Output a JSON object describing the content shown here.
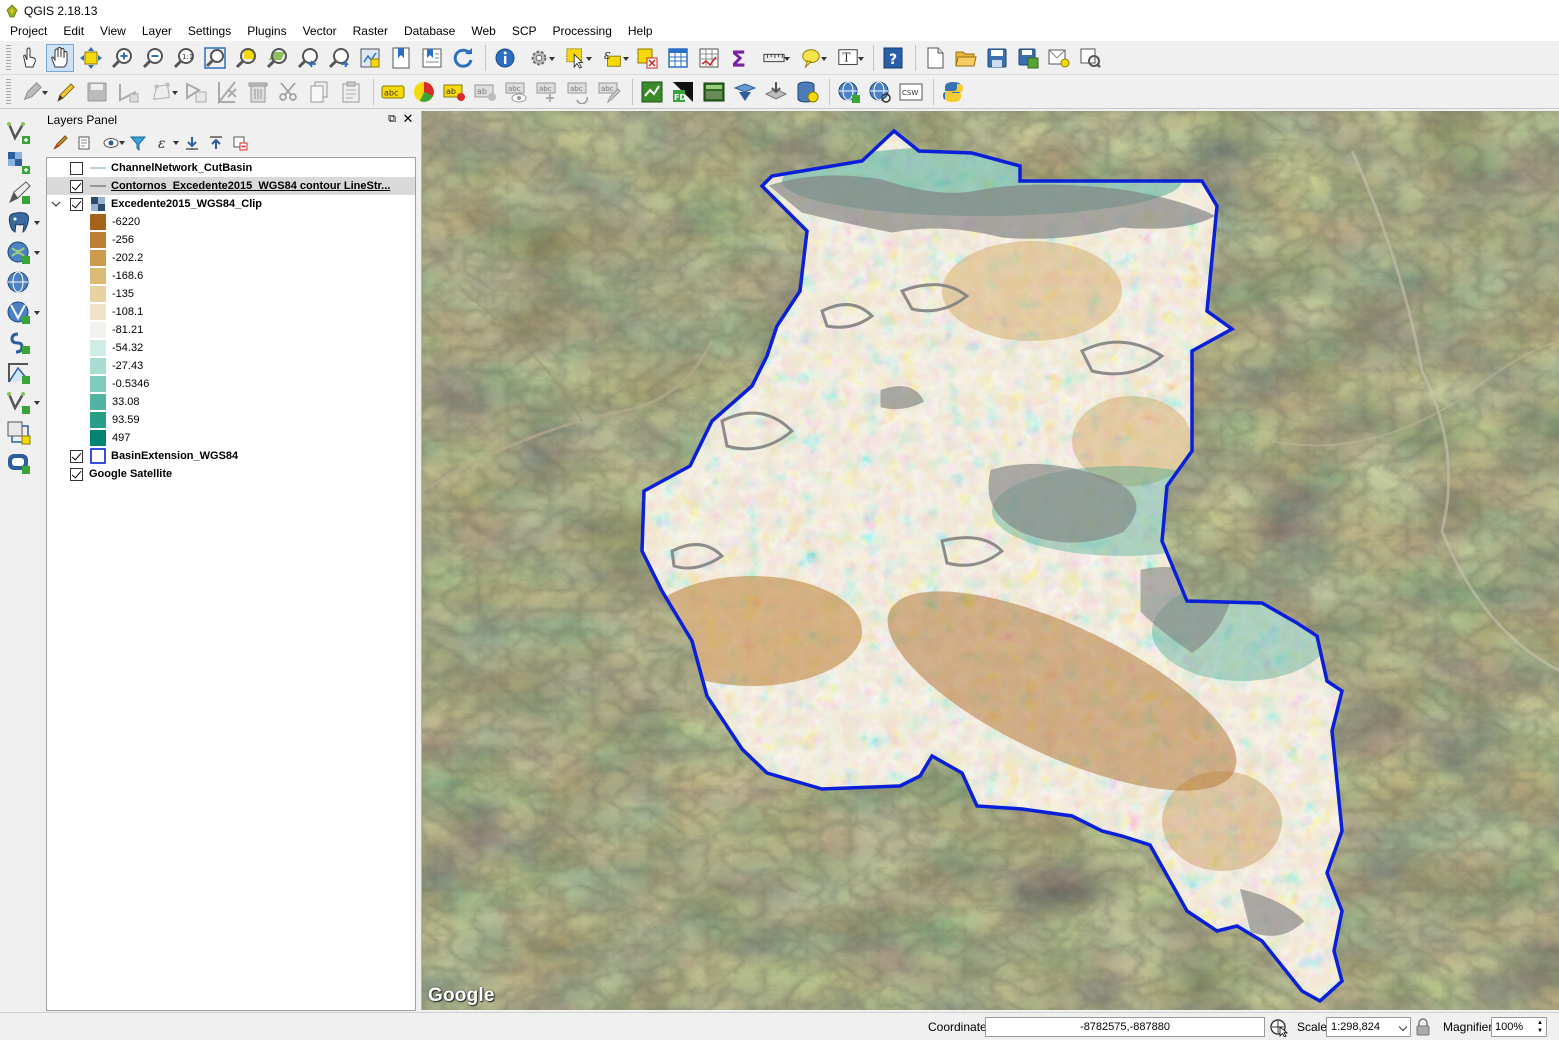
{
  "window": {
    "title": "QGIS 2.18.13"
  },
  "menu": [
    "Project",
    "Edit",
    "View",
    "Layer",
    "Settings",
    "Plugins",
    "Vector",
    "Raster",
    "Database",
    "Web",
    "SCP",
    "Processing",
    "Help"
  ],
  "toolbar1": {
    "groups": [
      [
        "touch-icon",
        "pan-icon",
        "pan-to-selection-icon",
        "zoom-in-icon",
        "zoom-out-icon",
        "zoom-actual-size-icon",
        "zoom-full-icon",
        "zoom-to-selection-icon",
        "zoom-to-layer-icon",
        "zoom-last-icon",
        "zoom-next-icon",
        "new-map-view-icon",
        "new-bookmark-icon",
        "show-bookmarks-icon",
        "refresh-icon"
      ],
      [
        "identify-icon",
        "run-feature-action-icon",
        "select-features-icon",
        "select-by-expression-icon",
        "deselect-icon",
        "attribute-table-icon",
        "field-calculator-icon",
        "statistical-summary-icon",
        "measure-line-icon",
        "map-tips-icon",
        "text-annotation-icon"
      ],
      [
        "help-icon"
      ],
      [
        "new-project-icon",
        "open-project-icon",
        "save-project-icon",
        "save-as-icon",
        "new-print-composer-icon",
        "composer-manager-icon"
      ]
    ]
  },
  "toolbar2": {
    "groups": [
      [
        "current-edits-icon",
        "toggle-editing-icon",
        "save-edits-icon",
        "add-feature-icon",
        "node-tool-icon",
        "move-feature-icon",
        "delete-selected-icon",
        "cut-features-icon",
        "copy-features-icon",
        "paste-features-icon"
      ],
      [
        "layer-labeling-icon",
        "layer-diagram-icon",
        "pin-labels-icon",
        "highlight-pinned-labels-icon",
        "show-hide-labels-icon",
        "move-label-icon",
        "rotate-label-icon",
        "change-label-icon"
      ],
      [
        "scp-raster-icon",
        "scp-roi-icon",
        "scp-band-set-icon",
        "scp-signature-icon",
        "scp-download-icon",
        "scp-database-icon"
      ],
      [
        "add-wms-icon",
        "add-wfs-icon",
        "add-csw-icon"
      ],
      [
        "python-console-icon"
      ]
    ],
    "csw_label": "CSW"
  },
  "side_toolbar": [
    "add-vector-layer-icon",
    "add-raster-layer-icon",
    "add-delimited-text-icon",
    "add-postgis-layer-icon",
    "add-spatialite-layer-icon",
    "add-wms-layer-icon",
    "add-wcs-layer-icon",
    "add-wfs-layer-icon",
    "create-shapefile-layer-icon",
    "add-virtual-layer-icon",
    "new-temporary-layer-icon",
    "add-oracle-layer-icon"
  ],
  "layers_panel": {
    "title": "Layers Panel",
    "tools": [
      "style-manager-icon",
      "add-group-icon",
      "manage-map-themes-icon",
      "filter-legend-icon",
      "filter-by-expression-icon",
      "expand-all-icon",
      "collapse-all-icon",
      "remove-layer-icon"
    ],
    "layers": [
      {
        "name": "ChannelNetwork_CutBasin",
        "checked": false,
        "symbol": "line"
      },
      {
        "name": "Contornos_Excedente2015_WGS84 contour LineStr...",
        "checked": true,
        "symbol": "line",
        "selected": true
      },
      {
        "name": "Excedente2015_WGS84_Clip",
        "checked": true,
        "symbol": "raster",
        "expanded": true
      },
      {
        "name": "BasinExtension_WGS84",
        "checked": true,
        "symbol": "polygon-outline"
      },
      {
        "name": "Google Satellite",
        "checked": true,
        "symbol": "none"
      }
    ],
    "legend": [
      {
        "value": "-6220",
        "color": "#a6611a"
      },
      {
        "value": "-256",
        "color": "#bb7f35"
      },
      {
        "value": "-202.2",
        "color": "#cc9c4e"
      },
      {
        "value": "-168.6",
        "color": "#dcbb76"
      },
      {
        "value": "-135",
        "color": "#e7d2a3"
      },
      {
        "value": "-108.1",
        "color": "#efe3cb"
      },
      {
        "value": "-81.21",
        "color": "#f4f2ee"
      },
      {
        "value": "-54.32",
        "color": "#d0ece6"
      },
      {
        "value": "-27.43",
        "color": "#a9ddd2"
      },
      {
        "value": "-0.5346",
        "color": "#80cbbd"
      },
      {
        "value": "33.08",
        "color": "#53b3a2"
      },
      {
        "value": "93.59",
        "color": "#2a9d88"
      },
      {
        "value": "497",
        "color": "#018571"
      }
    ]
  },
  "map": {
    "watermark": "Google",
    "basin_outline_color": "#0a1fd8",
    "contour_color": "#808080"
  },
  "status": {
    "coordinate_label": "Coordinate",
    "coordinate_value": "-8782575,-887880",
    "scale_label": "Scale",
    "scale_value": "1:298,824",
    "magnifier_label": "Magnifier",
    "magnifier_value": "100%"
  }
}
